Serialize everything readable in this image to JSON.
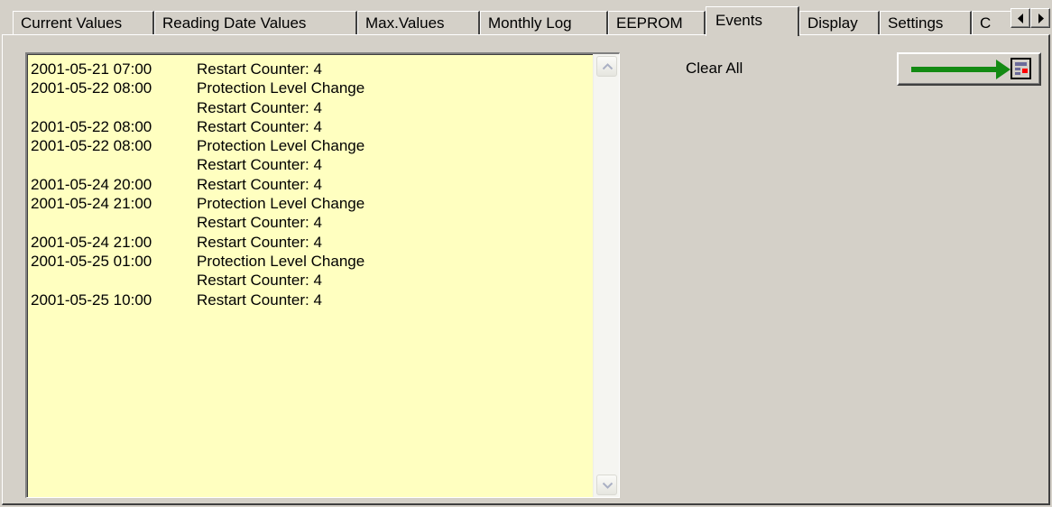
{
  "tabs": [
    {
      "label": "Current Values",
      "active": false
    },
    {
      "label": "Reading Date Values",
      "active": false
    },
    {
      "label": "Max.Values",
      "active": false
    },
    {
      "label": "Monthly Log",
      "active": false
    },
    {
      "label": "EEPROM",
      "active": false
    },
    {
      "label": "Events",
      "active": true
    },
    {
      "label": "Display",
      "active": false
    },
    {
      "label": "Settings",
      "active": false
    },
    {
      "label": "C",
      "active": false
    }
  ],
  "events": [
    {
      "datetime": "2001-05-21 07:00",
      "text": "Restart Counter: 4"
    },
    {
      "datetime": "2001-05-22 08:00",
      "text": "Protection Level Change"
    },
    {
      "datetime": "",
      "text": "Restart Counter: 4"
    },
    {
      "datetime": "2001-05-22 08:00",
      "text": "Restart Counter: 4"
    },
    {
      "datetime": "2001-05-22 08:00",
      "text": "Protection Level Change"
    },
    {
      "datetime": "",
      "text": "Restart Counter: 4"
    },
    {
      "datetime": "2001-05-24 20:00",
      "text": "Restart Counter: 4"
    },
    {
      "datetime": "2001-05-24 21:00",
      "text": "Protection Level Change"
    },
    {
      "datetime": "",
      "text": "Restart Counter: 4"
    },
    {
      "datetime": "2001-05-24 21:00",
      "text": "Restart Counter: 4"
    },
    {
      "datetime": "2001-05-25 01:00",
      "text": "Protection Level Change"
    },
    {
      "datetime": "",
      "text": "Restart Counter: 4"
    },
    {
      "datetime": "2001-05-25 10:00",
      "text": "Restart Counter: 4"
    }
  ],
  "clear_all_label": "Clear All",
  "export_button": {
    "icon": "arrow-to-device-icon",
    "arrow_color": "#138a13",
    "device_color": "#ff0000"
  },
  "colors": {
    "list_background": "#ffffc0",
    "panel_background": "#d4d0c8"
  }
}
